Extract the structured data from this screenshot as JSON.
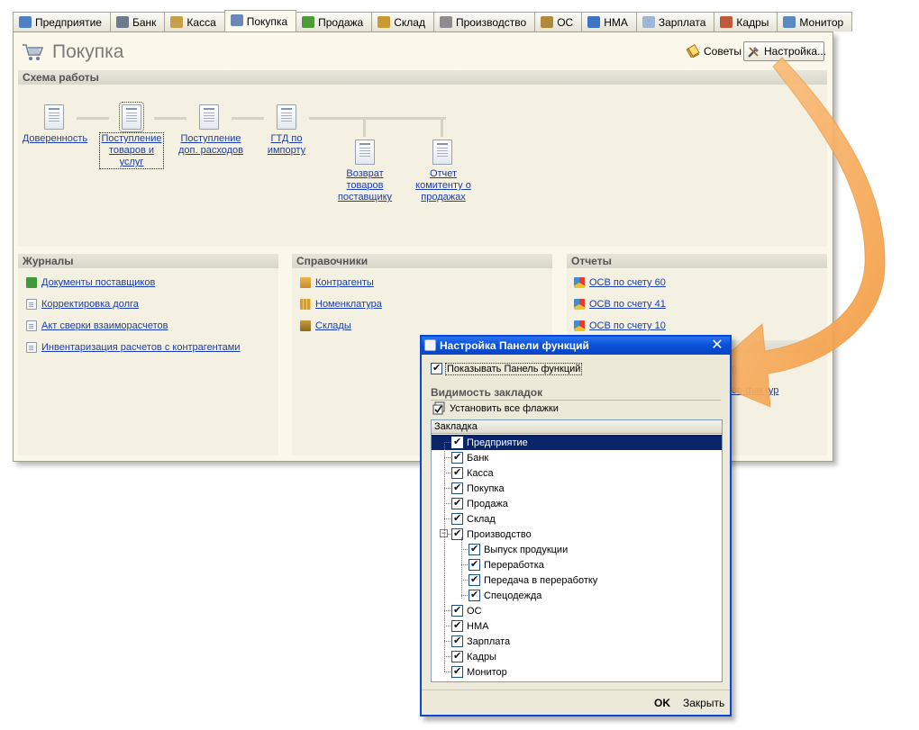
{
  "tabs": [
    {
      "label": "Предприятие",
      "color": "#4f7fc4"
    },
    {
      "label": "Банк",
      "color": "#6d7b8c"
    },
    {
      "label": "Касса",
      "color": "#c6a049"
    },
    {
      "label": "Покупка",
      "color": "#6a8ab5",
      "active": true
    },
    {
      "label": "Продажа",
      "color": "#4f9b3a"
    },
    {
      "label": "Склад",
      "color": "#c89a33"
    },
    {
      "label": "Производство",
      "color": "#8d8d8d"
    },
    {
      "label": "ОС",
      "color": "#b08a3a"
    },
    {
      "label": "НМА",
      "color": "#3c73c4"
    },
    {
      "label": "Зарплата",
      "color": "#9fb6d4"
    },
    {
      "label": "Кадры",
      "color": "#c05a3a"
    },
    {
      "label": "Монитор",
      "color": "#5a8ac0"
    }
  ],
  "window": {
    "title": "Покупка",
    "tips_label": "Советы",
    "settings_label": "Настройка..."
  },
  "scheme": {
    "heading": "Схема работы",
    "items": [
      {
        "label": "Доверенность"
      },
      {
        "label": "Поступление товаров и услуг"
      },
      {
        "label": "Поступление доп. расходов"
      },
      {
        "label": "ГТД по импорту"
      },
      {
        "label": "Возврат товаров поставщику"
      },
      {
        "label": "Отчет комитенту о продажах"
      }
    ]
  },
  "journals": {
    "heading": "Журналы",
    "items": [
      {
        "label": "Документы поставщиков",
        "icon": "green-journal-icon"
      },
      {
        "label": "Корректировка долга",
        "icon": "document-icon"
      },
      {
        "label": "Акт сверки взаиморасчетов",
        "icon": "document-icon"
      },
      {
        "label": "Инвентаризация расчетов с контрагентами",
        "icon": "document-icon"
      }
    ]
  },
  "catalogs": {
    "heading": "Справочники",
    "items": [
      {
        "label": "Контрагенты",
        "icon": "counterparties-icon"
      },
      {
        "label": "Номенклатура",
        "icon": "nomenclature-icon"
      },
      {
        "label": "Склады",
        "icon": "warehouse-icon"
      }
    ]
  },
  "reports": {
    "heading": "Отчеты",
    "items": [
      {
        "label": "ОСВ по счету 60",
        "icon": "report-ball-icon"
      },
      {
        "label": "ОСВ по счету 41",
        "icon": "report-ball-icon"
      },
      {
        "label": "ОСВ по счету 10",
        "icon": "report-ball-icon"
      }
    ],
    "partial_link_1": "р",
    "partial_link_2": "ов-фактур"
  },
  "dialog": {
    "title": "Настройка Панели функций",
    "show_panel_label": "Показывать Панель функций",
    "show_panel_checked": true,
    "visibility_heading": "Видимость закладок",
    "set_all_label": "Установить все флажки",
    "column_header": "Закладка",
    "tree": [
      {
        "label": "Предприятие",
        "level": 0,
        "checked": true,
        "selected": true
      },
      {
        "label": "Банк",
        "level": 0,
        "checked": true
      },
      {
        "label": "Касса",
        "level": 0,
        "checked": true
      },
      {
        "label": "Покупка",
        "level": 0,
        "checked": true
      },
      {
        "label": "Продажа",
        "level": 0,
        "checked": true
      },
      {
        "label": "Склад",
        "level": 0,
        "checked": true
      },
      {
        "label": "Производство",
        "level": 0,
        "checked": true,
        "expanded": true
      },
      {
        "label": "Выпуск продукции",
        "level": 1,
        "checked": true
      },
      {
        "label": "Переработка",
        "level": 1,
        "checked": true
      },
      {
        "label": "Передача в переработку",
        "level": 1,
        "checked": true
      },
      {
        "label": "Спецодежда",
        "level": 1,
        "checked": true
      },
      {
        "label": "ОС",
        "level": 0,
        "checked": true
      },
      {
        "label": "НМА",
        "level": 0,
        "checked": true
      },
      {
        "label": "Зарплата",
        "level": 0,
        "checked": true
      },
      {
        "label": "Кадры",
        "level": 0,
        "checked": true
      },
      {
        "label": "Монитор",
        "level": 0,
        "checked": true
      }
    ],
    "ok_label": "OK",
    "close_label": "Закрыть"
  },
  "colors": {
    "link": "#1a3ea6",
    "dialog_title": "#0a47d4",
    "tree_selection": "#0a246a",
    "arrow": "#f5a04e"
  }
}
